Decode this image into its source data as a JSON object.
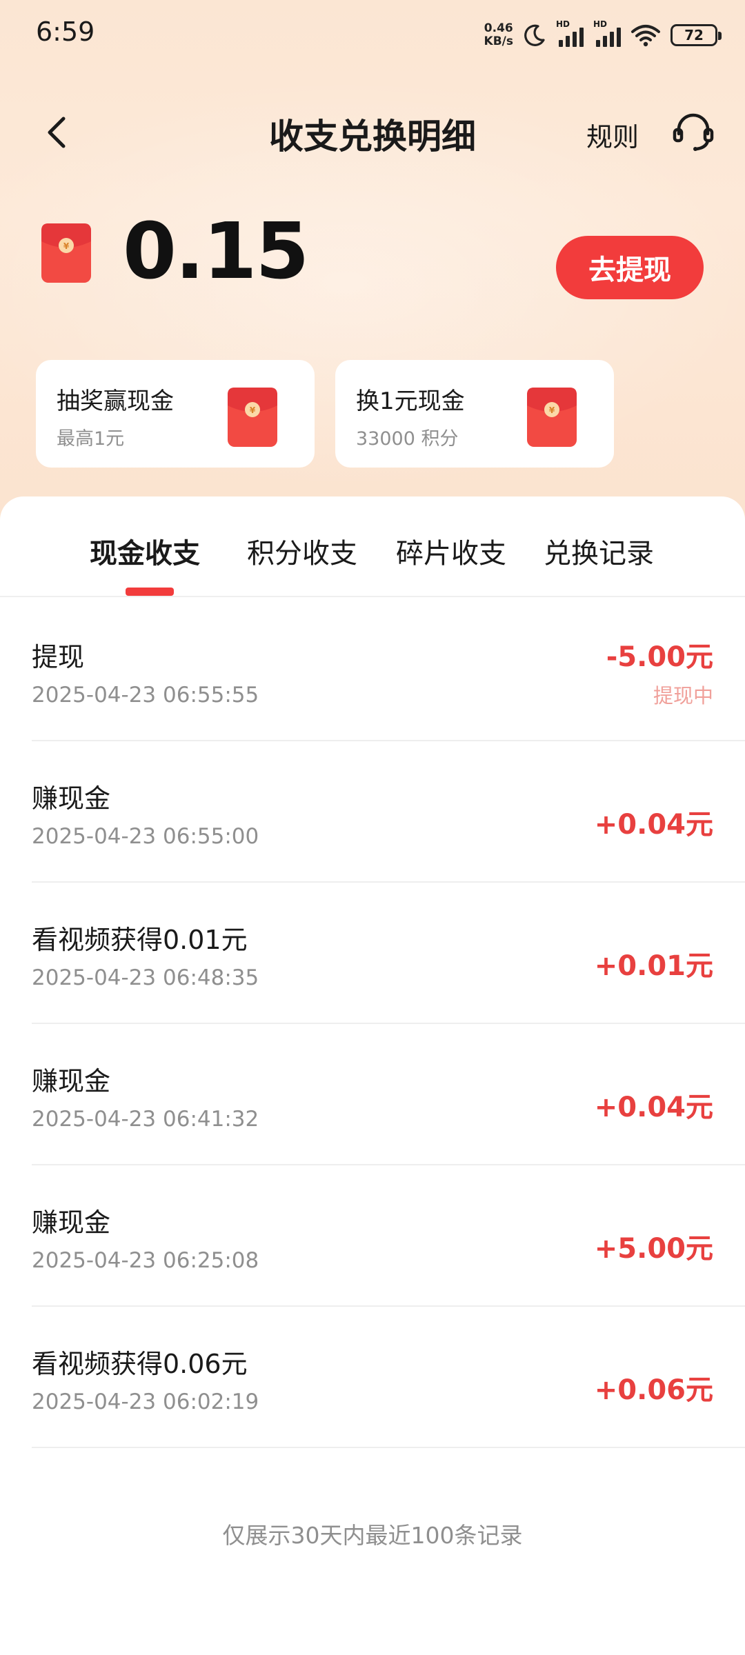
{
  "status_bar": {
    "time": "6:59",
    "net_speed_value": "0.46",
    "net_speed_unit": "KB/s",
    "hd_label": "HD",
    "battery": "72"
  },
  "header": {
    "title": "收支兑换明细",
    "rules_label": "规则",
    "back_icon": "chevron-left-icon",
    "service_icon": "headset-icon"
  },
  "balance": {
    "value": "0.15",
    "withdraw_label": "去提现",
    "icon": "red-envelope-icon"
  },
  "promos": [
    {
      "title": "抽奖赢现金",
      "subtitle": "最高1元",
      "icon": "red-envelope-icon"
    },
    {
      "title": "换1元现金",
      "subtitle": "33000 积分",
      "icon": "red-envelope-icon"
    }
  ],
  "tabs": [
    {
      "label": "现金收支",
      "active": true
    },
    {
      "label": "积分收支",
      "active": false
    },
    {
      "label": "碎片收支",
      "active": false
    },
    {
      "label": "兑换记录",
      "active": false
    }
  ],
  "records": [
    {
      "title": "提现",
      "time": "2025-04-23 06:55:55",
      "amount": "-5.00元",
      "status": "提现中"
    },
    {
      "title": "赚现金",
      "time": "2025-04-23 06:55:00",
      "amount": "+0.04元"
    },
    {
      "title": "看视频获得0.01元",
      "time": "2025-04-23 06:48:35",
      "amount": "+0.01元"
    },
    {
      "title": "赚现金",
      "time": "2025-04-23 06:41:32",
      "amount": "+0.04元"
    },
    {
      "title": "赚现金",
      "time": "2025-04-23 06:25:08",
      "amount": "+5.00元"
    },
    {
      "title": "看视频获得0.06元",
      "time": "2025-04-23 06:02:19",
      "amount": "+0.06元"
    }
  ],
  "footer": {
    "note": "仅展示30天内最近100条记录"
  },
  "colors": {
    "accent": "#f23c3c",
    "amount": "#e8403f",
    "status_pending": "#f0a09a",
    "header_bg": "#fbe6d3"
  }
}
